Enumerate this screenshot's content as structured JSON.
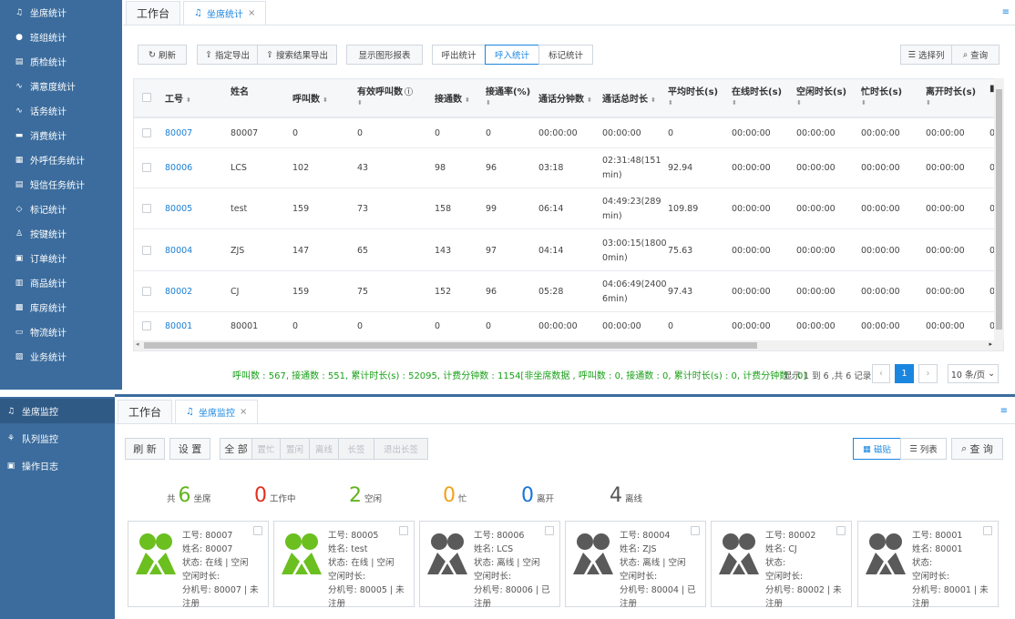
{
  "top": {
    "sidebar": {
      "items": [
        {
          "label": "坐席统计",
          "icon": "headset-icon",
          "glyph": "♫"
        },
        {
          "label": "班组统计",
          "icon": "group-icon",
          "glyph": "●"
        },
        {
          "label": "质检统计",
          "icon": "checklist-icon",
          "glyph": "▤"
        },
        {
          "label": "满意度统计",
          "icon": "pulse-icon",
          "glyph": "∿"
        },
        {
          "label": "话务统计",
          "icon": "pulse-icon",
          "glyph": "∿"
        },
        {
          "label": "消费统计",
          "icon": "card-icon",
          "glyph": "▬"
        },
        {
          "label": "外呼任务统计",
          "icon": "grid-icon",
          "glyph": "▦"
        },
        {
          "label": "短信任务统计",
          "icon": "document-icon",
          "glyph": "▤"
        },
        {
          "label": "标记统计",
          "icon": "tag-icon",
          "glyph": "◇"
        },
        {
          "label": "按键统计",
          "icon": "keypad-icon",
          "glyph": "♙"
        },
        {
          "label": "订单统计",
          "icon": "order-icon",
          "glyph": "▣"
        },
        {
          "label": "商品统计",
          "icon": "shop-icon",
          "glyph": "▥"
        },
        {
          "label": "库房统计",
          "icon": "warehouse-icon",
          "glyph": "▩"
        },
        {
          "label": "物流统计",
          "icon": "truck-icon",
          "glyph": "▭"
        },
        {
          "label": "业务统计",
          "icon": "chart-icon",
          "glyph": "▨"
        }
      ]
    },
    "tabs": {
      "home": "工作台",
      "active": "坐席统计",
      "close": "×"
    },
    "toolbar": {
      "refresh": "刷新",
      "export_selected": "指定导出",
      "export_results": "搜索结果导出",
      "show_chart": "显示图形报表",
      "outbound": "呼出统计",
      "inbound": "呼入统计",
      "mark": "标记统计",
      "choose_columns": "选择列",
      "query": "查询"
    },
    "table": {
      "headers": [
        "工号",
        "姓名",
        "呼叫数",
        "有效呼叫数",
        "接通数",
        "接通率(%)",
        "通话分钟数",
        "通话总时长",
        "平均时长(s)",
        "在线时长(s)",
        "空闲时长(s)",
        "忙时长(s)",
        "离开时长(s)"
      ],
      "rows": [
        {
          "id": "80007",
          "name": "80007",
          "calls": "0",
          "valid": "0",
          "connected": "0",
          "rate": "0",
          "minutes": "00:00:00",
          "total1": "00:00:00",
          "total2": "",
          "avg": "0",
          "online": "00:00:00",
          "idle": "00:00:00",
          "busy": "00:00:00",
          "away": "00:00:00",
          "extra": "0"
        },
        {
          "id": "80006",
          "name": "LCS",
          "calls": "102",
          "valid": "43",
          "connected": "98",
          "rate": "96",
          "minutes": "03:18",
          "total1": "02:31:48(151",
          "total2": "min)",
          "avg": "92.94",
          "online": "00:00:00",
          "idle": "00:00:00",
          "busy": "00:00:00",
          "away": "00:00:00",
          "extra": "0"
        },
        {
          "id": "80005",
          "name": "test",
          "calls": "159",
          "valid": "73",
          "connected": "158",
          "rate": "99",
          "minutes": "06:14",
          "total1": "04:49:23(289",
          "total2": "min)",
          "avg": "109.89",
          "online": "00:00:00",
          "idle": "00:00:00",
          "busy": "00:00:00",
          "away": "00:00:00",
          "extra": "0"
        },
        {
          "id": "80004",
          "name": "ZJS",
          "calls": "147",
          "valid": "65",
          "connected": "143",
          "rate": "97",
          "minutes": "04:14",
          "total1": "03:00:15(1800",
          "total2": "0min)",
          "avg": "75.63",
          "online": "00:00:00",
          "idle": "00:00:00",
          "busy": "00:00:00",
          "away": "00:00:00",
          "extra": "0"
        },
        {
          "id": "80002",
          "name": "CJ",
          "calls": "159",
          "valid": "75",
          "connected": "152",
          "rate": "96",
          "minutes": "05:28",
          "total1": "04:06:49(2400",
          "total2": "6min)",
          "avg": "97.43",
          "online": "00:00:00",
          "idle": "00:00:00",
          "busy": "00:00:00",
          "away": "00:00:00",
          "extra": "0"
        },
        {
          "id": "80001",
          "name": "80001",
          "calls": "0",
          "valid": "0",
          "connected": "0",
          "rate": "0",
          "minutes": "00:00:00",
          "total1": "00:00:00",
          "total2": "",
          "avg": "0",
          "online": "00:00:00",
          "idle": "00:00:00",
          "busy": "00:00:00",
          "away": "00:00:00",
          "extra": "0"
        }
      ]
    },
    "summary": "呼叫数 : 567, 接通数 : 551, 累计时长(s) : 52095, 计费分钟数 : 1154[非坐席数据 ,   呼叫数 : 0, 接通数 : 0, 累计时长(s) : 0, 计费分钟数 : 0]",
    "pagination": {
      "info": "显示 1 到 6 ,共 6 记录",
      "prev": "‹",
      "current": "1",
      "next": "›",
      "page_size": "10 条/页"
    }
  },
  "bottom": {
    "sidebar": {
      "items": [
        {
          "label": "坐席监控",
          "icon": "headset-icon",
          "glyph": "♫"
        },
        {
          "label": "队列监控",
          "icon": "queue-icon",
          "glyph": "⚘"
        },
        {
          "label": "操作日志",
          "icon": "log-icon",
          "glyph": "▣"
        }
      ]
    },
    "tabs": {
      "home": "工作台",
      "active": "坐席监控",
      "close": "×"
    },
    "toolbar": {
      "refresh": "刷 新",
      "settings": "设 置",
      "all": "全 部",
      "set_busy": "置忙",
      "set_idle": "置闲",
      "offline": "离线",
      "sign": "长签",
      "logout_sign": "退出长签",
      "tile": "磁贴",
      "list": "列表",
      "query": "查 询"
    },
    "stats": {
      "total_prefix": "共",
      "total": "6",
      "total_label": "坐席",
      "working": "0",
      "working_label": "工作中",
      "idle": "2",
      "idle_label": "空闲",
      "busy": "0",
      "busy_label": "忙",
      "away": "0",
      "away_label": "离开",
      "offline": "4",
      "offline_label": "离线",
      "colors": {
        "total": "#63b31d",
        "working": "#e0301e",
        "idle": "#63b31d",
        "busy": "#f0a31e",
        "away": "#1a75d8",
        "offline": "#555555"
      }
    },
    "cards": [
      {
        "status": "online",
        "lines": [
          "工号: 80007",
          "姓名: 80007",
          "状态: 在线 | 空闲",
          "空闲时长:",
          "分机号: 80007 | 未注册"
        ]
      },
      {
        "status": "online",
        "lines": [
          "工号: 80005",
          "姓名: test",
          "状态: 在线 | 空闲",
          "空闲时长:",
          "分机号: 80005 | 未注册"
        ]
      },
      {
        "status": "offline",
        "lines": [
          "工号: 80006",
          "姓名: LCS",
          "状态: 离线 | 空闲",
          "空闲时长:",
          "分机号: 80006 | 已注册"
        ]
      },
      {
        "status": "offline",
        "lines": [
          "工号: 80004",
          "姓名: ZJS",
          "状态: 离线 | 空闲",
          "空闲时长:",
          "分机号: 80004 | 已注册"
        ]
      },
      {
        "status": "offline",
        "lines": [
          "工号: 80002",
          "姓名: CJ",
          "状态:",
          "空闲时长:",
          "分机号: 80002 | 未注册"
        ]
      },
      {
        "status": "offline",
        "lines": [
          "工号: 80001",
          "姓名: 80001",
          "状态:",
          "空闲时长:",
          "分机号: 80001 | 未注册"
        ]
      }
    ],
    "avatar_colors": {
      "online": "#6bbf1f",
      "offline": "#5a5a5a"
    }
  }
}
